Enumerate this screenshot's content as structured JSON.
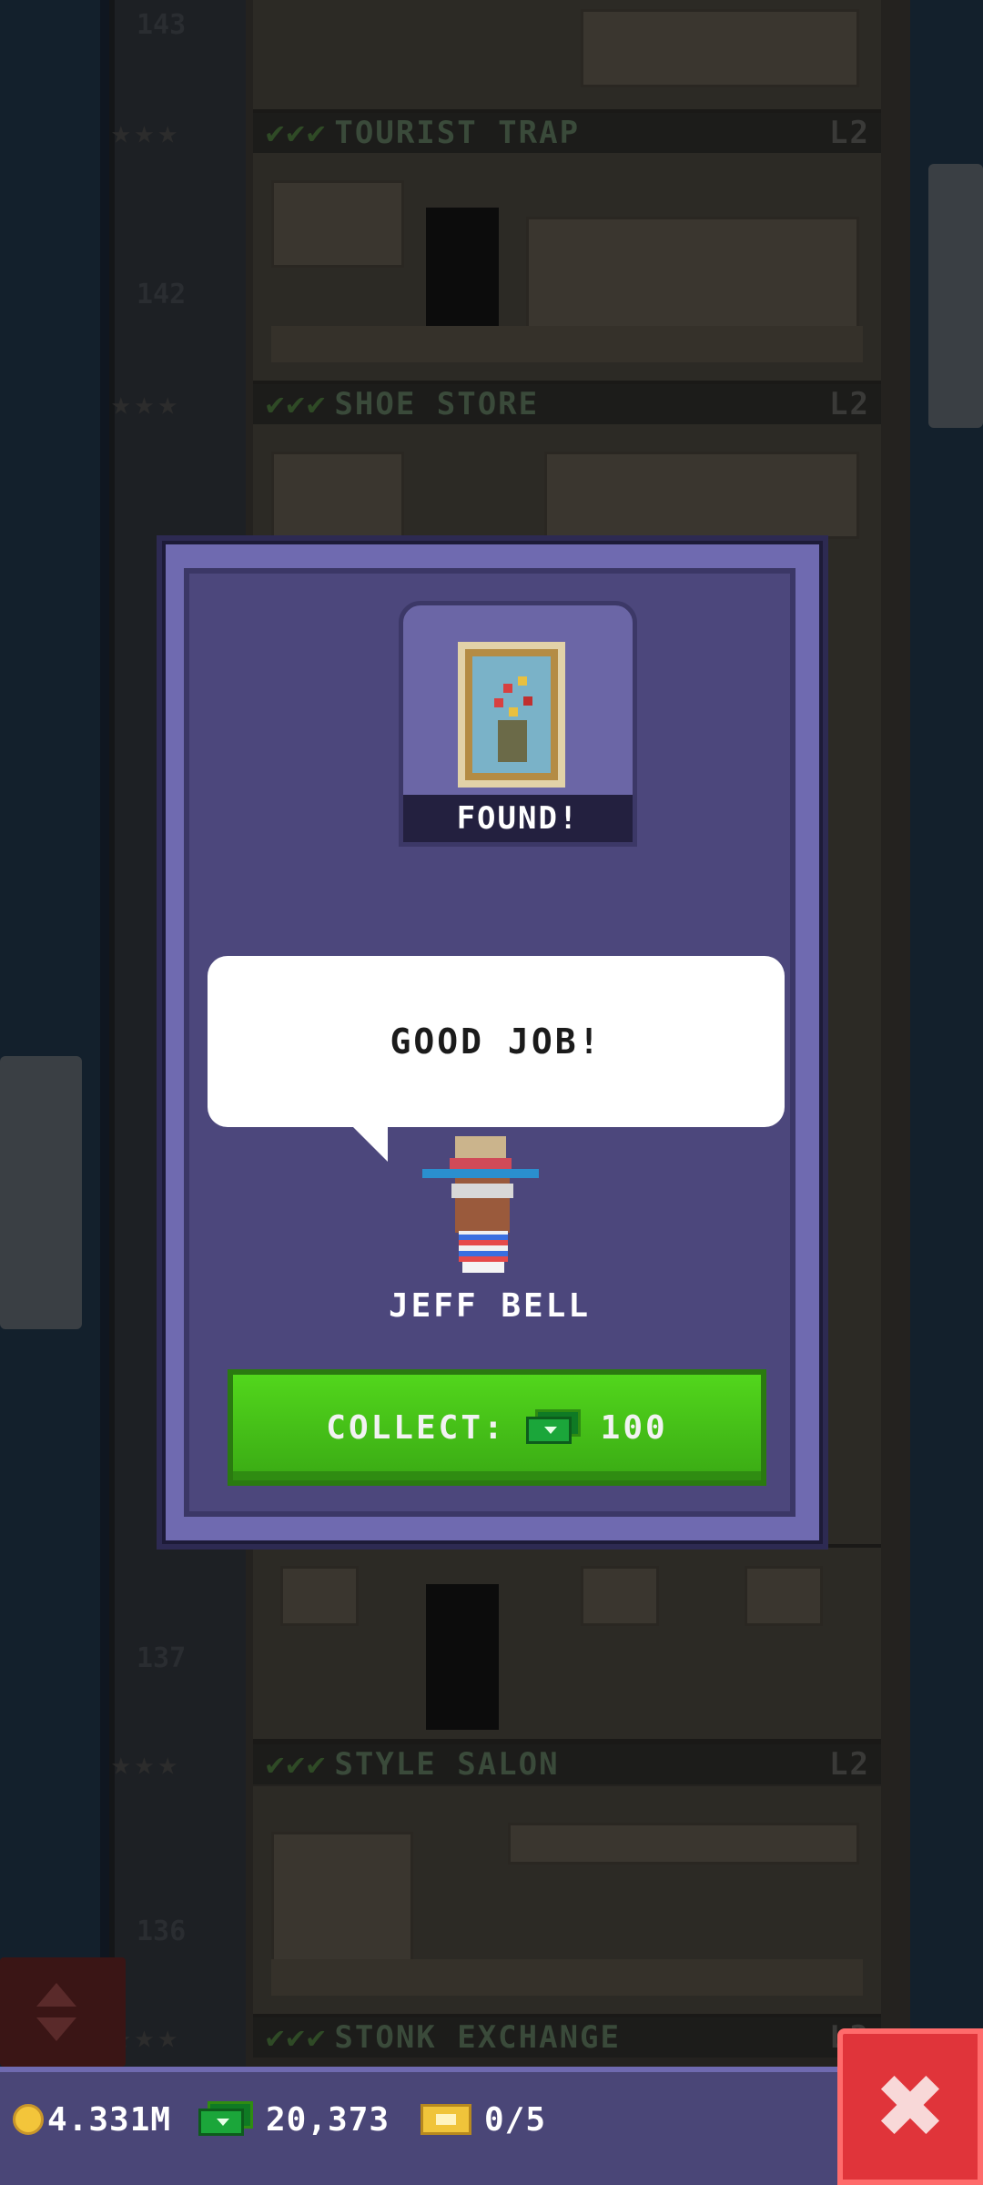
{
  "background_tower": {
    "floors": [
      {
        "number": "143",
        "name": "TOURIST TRAP",
        "level": "L2",
        "checks": "✔✔✔"
      },
      {
        "number": "142",
        "name": "SHOE STORE",
        "level": "L2",
        "checks": "✔✔✔"
      },
      {
        "number": "137",
        "name": "STYLE SALON",
        "level": "L2",
        "checks": "✔✔✔"
      },
      {
        "number": "136",
        "name": "STONK EXCHANGE",
        "level": "L2",
        "checks": "✔✔✔"
      }
    ]
  },
  "modal": {
    "item_status": "FOUND!",
    "speech_text": "GOOD JOB!",
    "character_name": "JEFF BELL",
    "collect_label": "COLLECT:",
    "collect_amount": "100",
    "collect_currency_icon": "bux-icon"
  },
  "hud": {
    "coins": "4.331M",
    "bux": "20,373",
    "tickets": "0/5",
    "coin_icon": "coin-icon",
    "bux_icon": "bux-icon",
    "ticket_icon": "ticket-icon"
  },
  "colors": {
    "modal_frame": "#6f6ab0",
    "modal_body": "#4c477c",
    "collect_button": "#3aaa14",
    "close_button": "#e0343a",
    "hud_bar": "#4a4677"
  }
}
